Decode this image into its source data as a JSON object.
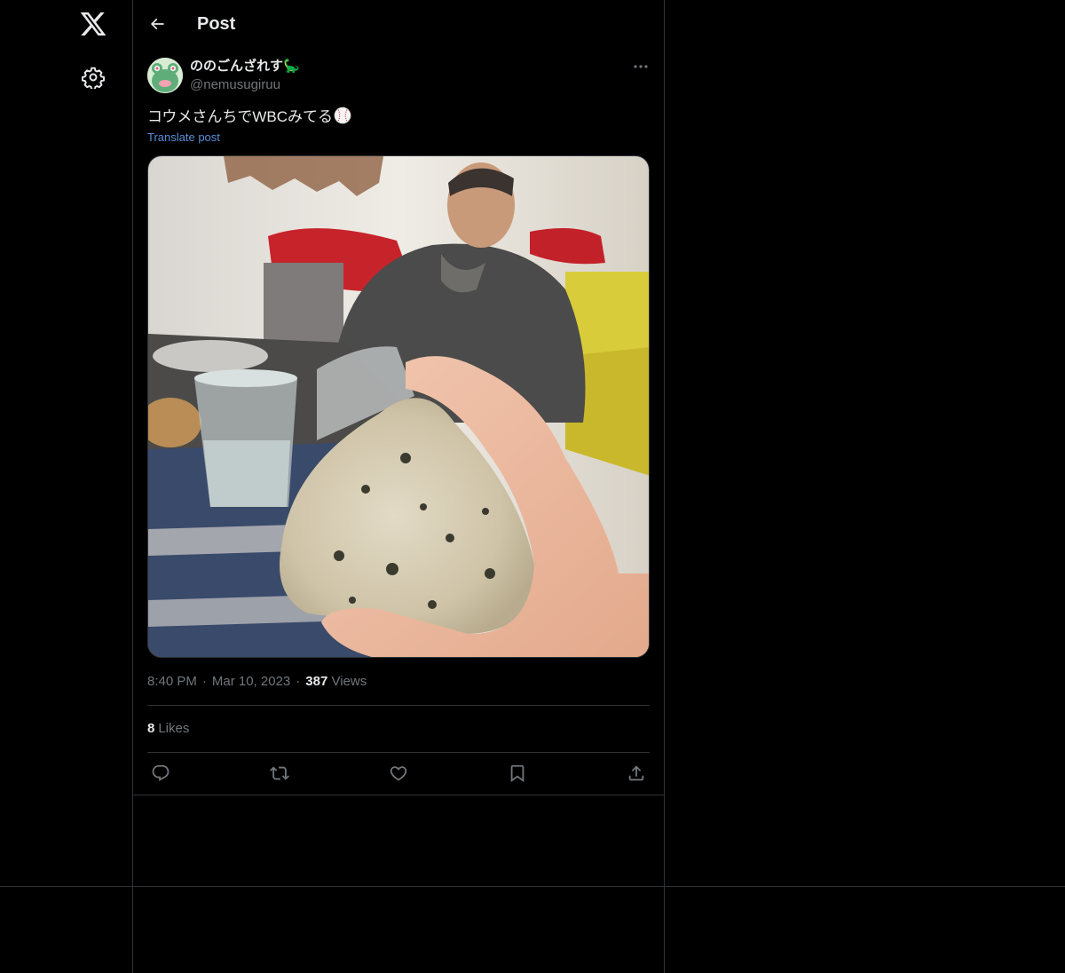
{
  "app": {
    "logo_icon": "x-logo-icon",
    "settings_icon": "gear-icon"
  },
  "header": {
    "title": "Post",
    "back_icon": "arrow-left-icon"
  },
  "post": {
    "display_name": "ののごんざれす🦕",
    "handle": "@nemusugiruu",
    "text": "コウメさんちでWBCみてる",
    "text_emoji": "baseball-icon",
    "translate_label": "Translate post",
    "media_description": "photo-rice-ball-in-hand",
    "time": "8:40 PM",
    "separator": "·",
    "date": "Mar 10, 2023",
    "views_count": "387",
    "views_label": "Views",
    "likes_count": "8",
    "likes_label": "Likes"
  },
  "actions": [
    {
      "icon": "reply-icon"
    },
    {
      "icon": "repost-icon"
    },
    {
      "icon": "like-icon"
    },
    {
      "icon": "bookmark-icon"
    },
    {
      "icon": "share-icon"
    }
  ],
  "colors": {
    "background": "#000000",
    "text_primary": "#e7e9ea",
    "text_secondary": "#71767b",
    "link": "#5a8fd8",
    "border": "#2f3336"
  }
}
